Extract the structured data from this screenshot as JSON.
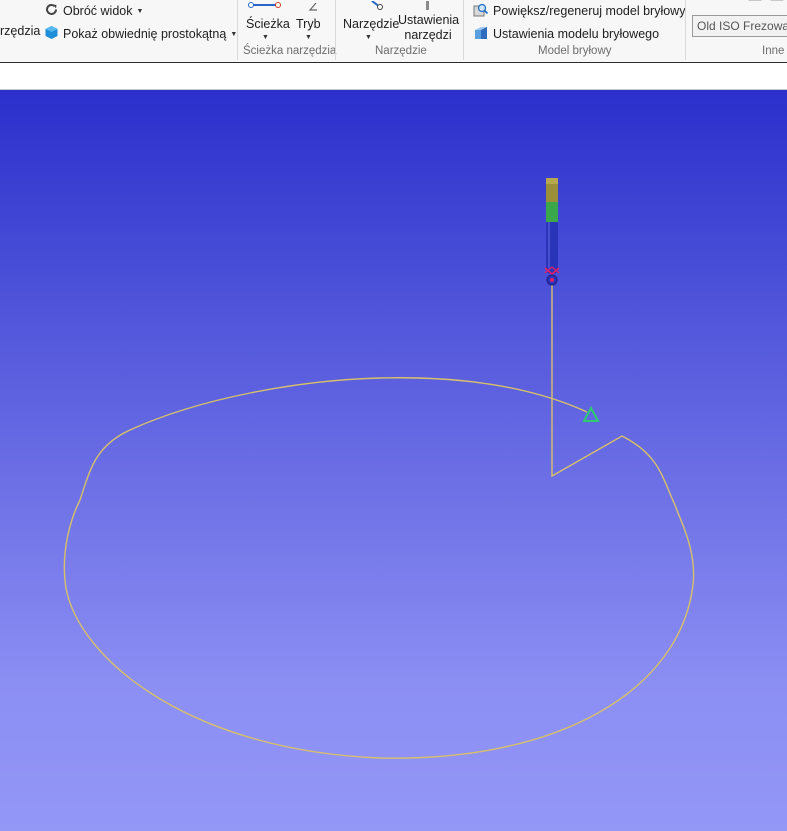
{
  "ribbon": {
    "left": {
      "partial_label": "rzędzia",
      "rotate_view": "Obróć widok",
      "show_bbox": "Pokaż obwiednię prostokątną"
    },
    "toolpath_group": {
      "path_label": "Ścieżka",
      "mode_label": "Tryb",
      "group_label": "Ścieżka narzędzia"
    },
    "tool_group": {
      "tool_label": "Narzędzie",
      "tool_settings_line1": "Ustawienia",
      "tool_settings_line2": "narzędzi",
      "group_label": "Narzędzie"
    },
    "solid_group": {
      "zoom_regen": "Powiększ/regeneruj model bryłowy",
      "solid_settings": "Ustawienia modelu bryłowego",
      "group_label": "Model bryłowy"
    },
    "other_group": {
      "combo_value": "Old ISO Frezowanie",
      "group_label": "Inne"
    }
  },
  "colors": {
    "toolpath": "#d7c06a",
    "tool_shank": "#2a34b8",
    "tool_holder_top": "#9c8f3a",
    "tool_holder_band": "#3aa84a",
    "start_marker": "#2ecc71",
    "tool_tip_marker": "#e0206a"
  },
  "icons": {
    "rotate_view": "rotate-icon",
    "show_bbox": "cube-icon",
    "zoom_regen": "solid-zoom-icon",
    "solid_settings": "solid-settings-icon",
    "toolpath": "toolpath-icon",
    "tool": "tool-icon"
  }
}
